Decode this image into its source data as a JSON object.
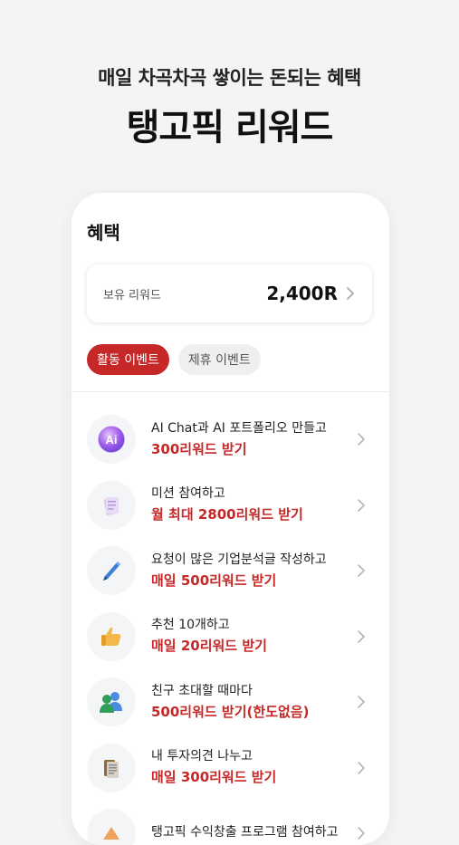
{
  "hero": {
    "subtitle": "매일 차곡차곡 쌓이는 돈되는 혜택",
    "title": "탱고픽 리워드"
  },
  "screen": {
    "title": "혜택",
    "reward_label": "보유 리워드",
    "reward_value": "2,400R"
  },
  "tabs": [
    {
      "label": "활동 이벤트",
      "active": true
    },
    {
      "label": "제휴 이벤트",
      "active": false
    }
  ],
  "items": [
    {
      "icon": "ai-chat-icon",
      "title": "AI Chat과 AI 포트폴리오 만들고",
      "reward": "300리워드 받기"
    },
    {
      "icon": "mission-document-icon",
      "title": "미션 참여하고",
      "reward": "월 최대 2800리워드 받기"
    },
    {
      "icon": "pencil-icon",
      "title": "요청이 많은 기업분석글 작성하고",
      "reward": "매일 500리워드 받기"
    },
    {
      "icon": "thumbs-up-icon",
      "title": "추천 10개하고",
      "reward": "매일 20리워드 받기"
    },
    {
      "icon": "invite-friends-icon",
      "title": "친구 초대할 때마다",
      "reward": "500리워드 받기(한도없음)"
    },
    {
      "icon": "opinion-document-icon",
      "title": "내 투자의견 나누고",
      "reward": "매일 300리워드 받기"
    },
    {
      "icon": "program-icon",
      "title": "탱고픽 수익창출 프로그램 참여하고",
      "reward": ""
    }
  ],
  "colors": {
    "accent": "#c62828",
    "background": "#f3f4f6"
  }
}
